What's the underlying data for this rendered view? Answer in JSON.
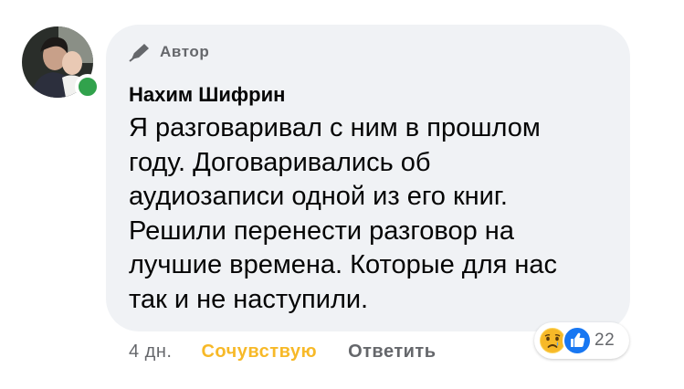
{
  "comment": {
    "author_badge": "Автор",
    "author_name": "Нахим Шифрин",
    "text": "Я разговаривал с ним в прошлом\nгоду. Договаривались об\nаудиозаписи одной из его книг.\nРешили перенести разговор на\nлучшие времена. Которые для нас\nтак и не наступили.",
    "online": true
  },
  "actions": {
    "time": "4 дн.",
    "like_label": "Сочувствую",
    "reply_label": "Ответить"
  },
  "reactions": {
    "icons": [
      "sad-reaction-icon",
      "like-reaction-icon"
    ],
    "count": "22"
  },
  "colors": {
    "bubble_bg": "#f0f2f5",
    "text": "#050505",
    "secondary": "#65676b",
    "reaction_accent": "#f7b928",
    "online": "#31a24c",
    "like_blue": "#1877f2"
  }
}
